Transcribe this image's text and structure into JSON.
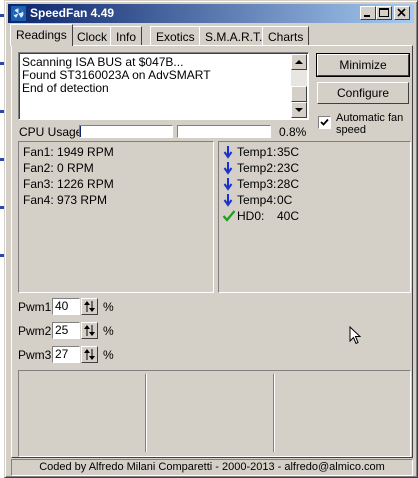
{
  "window": {
    "title": "SpeedFan 4.49"
  },
  "tabs": [
    "Readings",
    "Clock",
    "Info",
    "Exotics",
    "S.M.A.R.T.",
    "Charts"
  ],
  "log": {
    "lines": [
      "Scanning ISA BUS at $047B...",
      "Found ST3160023A on AdvSMART",
      "End of detection"
    ]
  },
  "buttons": {
    "minimize": "Minimize",
    "configure": "Configure"
  },
  "auto_fan": {
    "label": "Automatic fan speed",
    "checked": true
  },
  "cpu": {
    "label": "CPU Usage",
    "percent_text": "0.8%",
    "bars": [
      0.008,
      0.0
    ]
  },
  "fans": [
    {
      "label": "Fan1:",
      "value": "1949 RPM"
    },
    {
      "label": "Fan2:",
      "value": "0 RPM"
    },
    {
      "label": "Fan3:",
      "value": "1226 RPM"
    },
    {
      "label": "Fan4:",
      "value": "973 RPM"
    }
  ],
  "temps": [
    {
      "label": "Temp1:",
      "value": "35C",
      "icon": "arrow-down-icon"
    },
    {
      "label": "Temp2:",
      "value": "23C",
      "icon": "arrow-down-icon"
    },
    {
      "label": "Temp3:",
      "value": "28C",
      "icon": "arrow-down-icon"
    },
    {
      "label": "Temp4:",
      "value": "0C",
      "icon": "arrow-down-icon"
    },
    {
      "label": "HD0:",
      "value": "40C",
      "icon": "check-icon"
    }
  ],
  "pwm": [
    {
      "label": "Pwm1:",
      "value": "40",
      "unit": "%"
    },
    {
      "label": "Pwm2:",
      "value": "25",
      "unit": "%"
    },
    {
      "label": "Pwm3:",
      "value": "27",
      "unit": "%"
    }
  ],
  "status": {
    "text": "Coded by Alfredo Milani Comparetti - 2000-2013 - alfredo@almico.com"
  },
  "colors": {
    "title_start": "#0a246a",
    "title_end": "#a6caf0",
    "down_arrow": "#1a2fd0",
    "check": "#1aa01a"
  }
}
